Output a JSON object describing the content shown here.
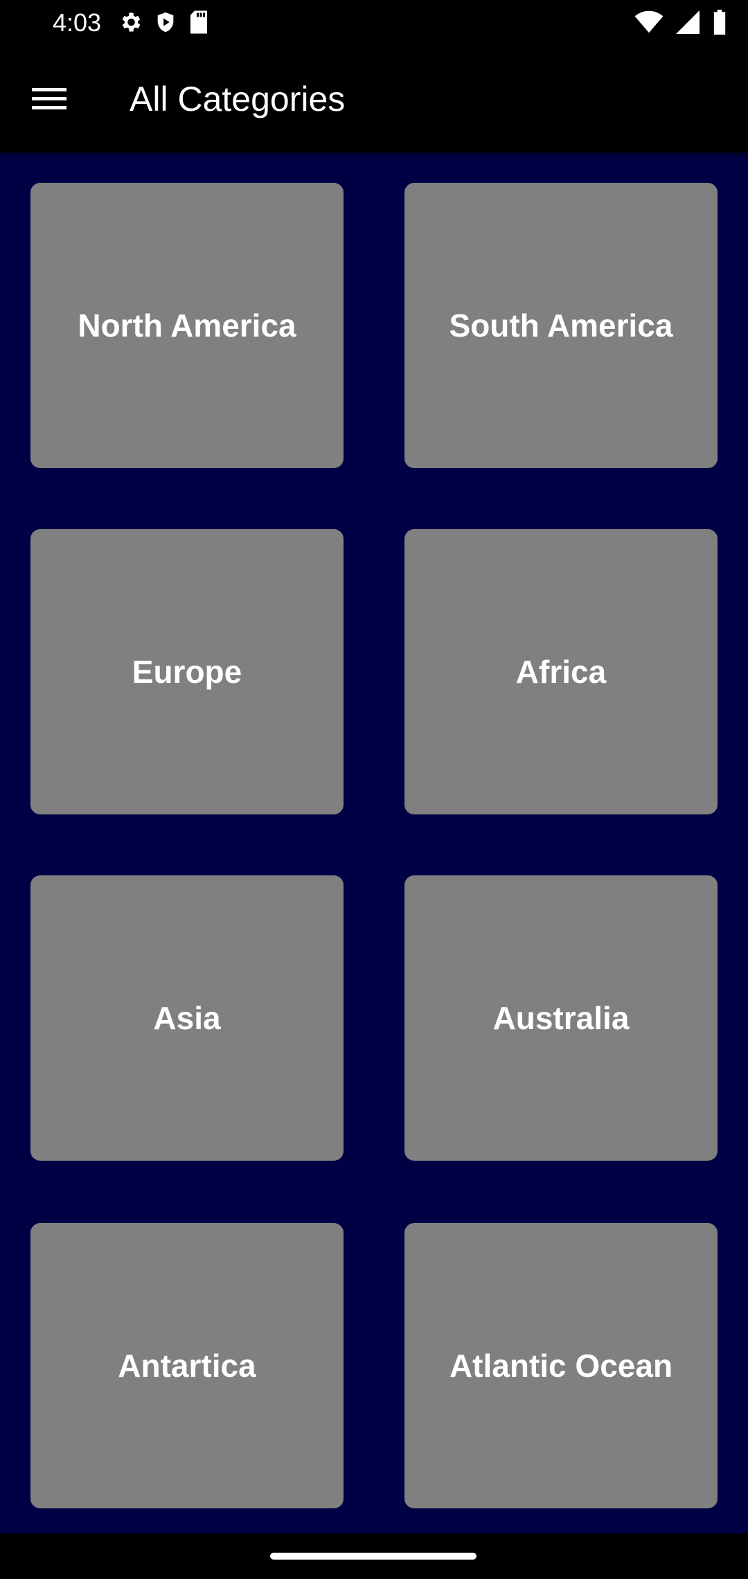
{
  "status_bar": {
    "time": "4:03",
    "left_icons": [
      "gear-icon",
      "shield-icon",
      "sd-card-icon"
    ],
    "right_icons": [
      "wifi-icon",
      "signal-icon",
      "battery-icon"
    ]
  },
  "app_bar": {
    "title": "All Categories",
    "menu_icon": "hamburger-menu-icon"
  },
  "categories": [
    {
      "label": "North America"
    },
    {
      "label": "South America"
    },
    {
      "label": "Europe"
    },
    {
      "label": "Africa"
    },
    {
      "label": "Asia"
    },
    {
      "label": "Australia"
    },
    {
      "label": "Antartica"
    },
    {
      "label": "Atlantic Ocean"
    }
  ],
  "colors": {
    "content_background": "#000045",
    "tile_background": "#808080",
    "bar_background": "#000000",
    "text": "#ffffff"
  }
}
